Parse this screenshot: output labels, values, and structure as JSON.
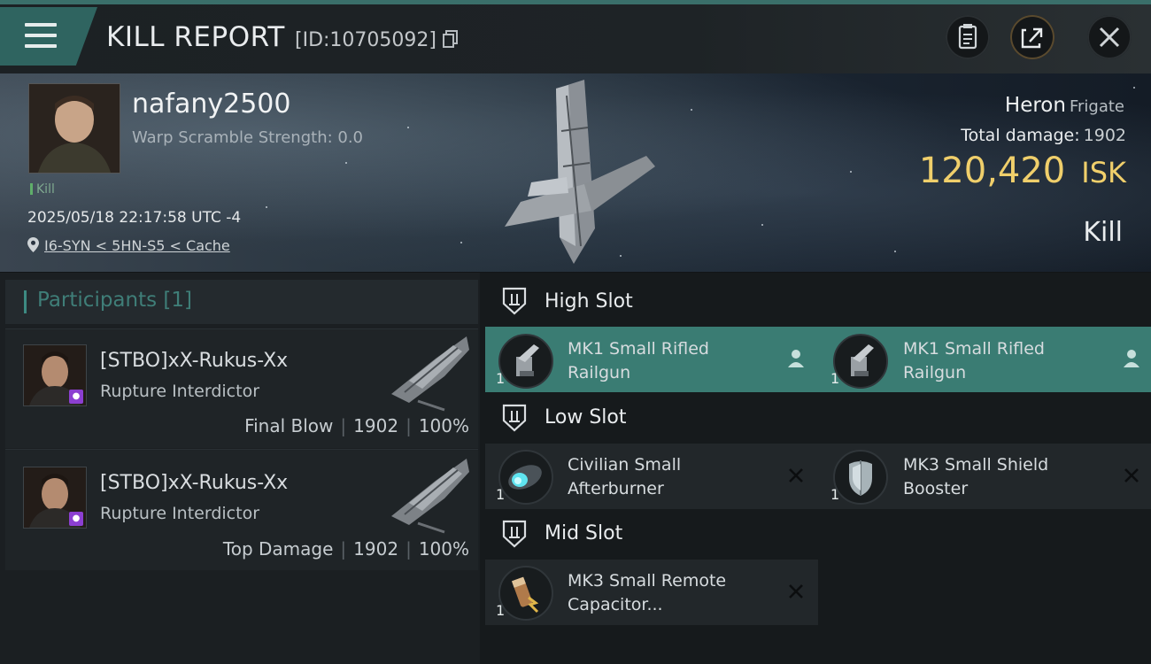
{
  "header": {
    "title": "KILL REPORT",
    "report_id": "[ID:10705092]"
  },
  "hero": {
    "pilot_name": "nafany2500",
    "warp_scramble": "Warp Scramble Strength: 0.0",
    "kill_tag": "Kill",
    "datetime": "2025/05/18 22:17:58 UTC -4",
    "location": "I6-SYN < 5HN-S5 < Cache",
    "ship_name": "Heron",
    "ship_class": "Frigate",
    "total_damage_label": "Total damage:",
    "total_damage_value": "1902",
    "isk_value": "120,420",
    "isk_unit": "ISK",
    "result": "Kill"
  },
  "participants": {
    "title": "Participants",
    "count": "[1]",
    "rows": [
      {
        "name": "[STBO]xX-Rukus-Xx",
        "ship": "Rupture Interdictor",
        "role": "Final Blow",
        "damage": "1902",
        "percent": "100%"
      },
      {
        "name": "[STBO]xX-Rukus-Xx",
        "ship": "Rupture Interdictor",
        "role": "Top Damage",
        "damage": "1902",
        "percent": "100%"
      }
    ]
  },
  "slots": {
    "high": {
      "label": "High Slot",
      "items": [
        {
          "line1": "MK1 Small Rifled",
          "line2": "Railgun",
          "qty": "1"
        },
        {
          "line1": "MK1 Small Rifled",
          "line2": "Railgun",
          "qty": "1"
        }
      ]
    },
    "low": {
      "label": "Low Slot",
      "items": [
        {
          "line1": "Civilian Small",
          "line2": "Afterburner",
          "qty": "1"
        },
        {
          "line1": "MK3 Small Shield",
          "line2": "Booster",
          "qty": "1"
        }
      ]
    },
    "mid": {
      "label": "Mid Slot",
      "items": [
        {
          "line1": "MK3 Small Remote",
          "line2": "Capacitor...",
          "qty": "1"
        }
      ]
    }
  },
  "colors": {
    "accent": "#3a7c73",
    "isk": "#f0cf6b",
    "drop_badge": "#8c3fd1"
  }
}
